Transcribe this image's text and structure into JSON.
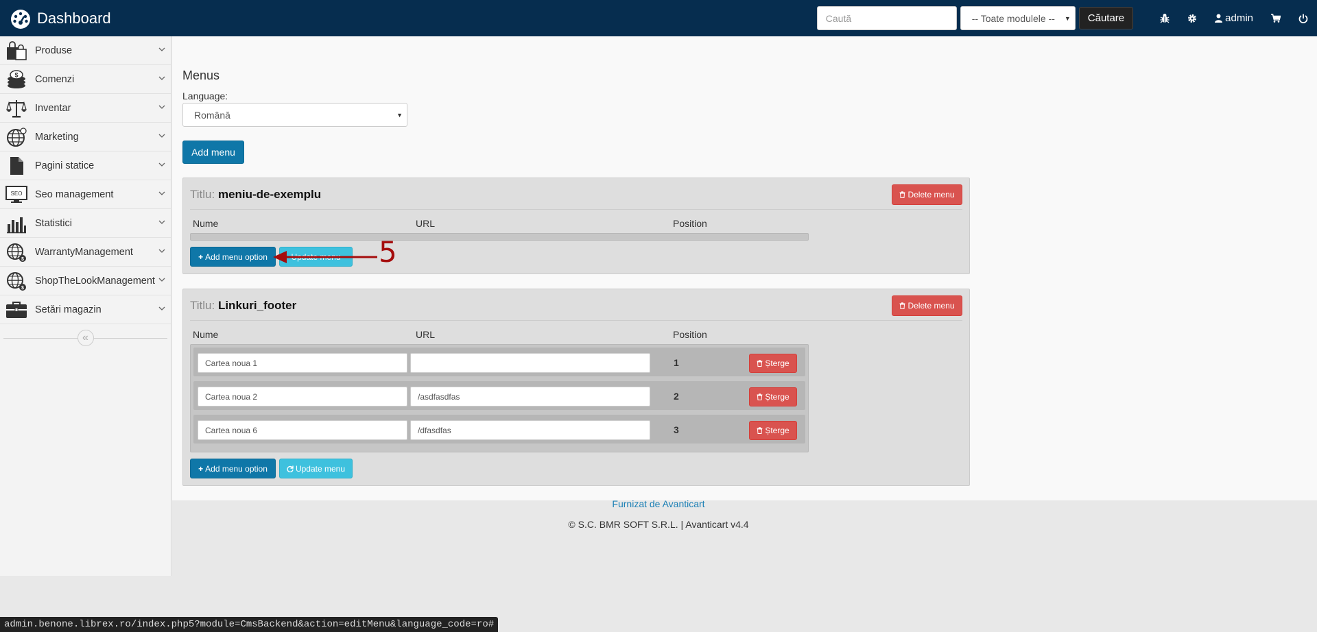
{
  "app": {
    "brand": "Dashboard"
  },
  "topbar": {
    "search_placeholder": "Caută",
    "module_select": "-- Toate modulele --",
    "search_button": "Căutare",
    "user": "admin",
    "icons": [
      "bug-icon",
      "gear-icon",
      "user-icon",
      "cart-icon",
      "power-icon"
    ]
  },
  "sidebar": {
    "items": [
      {
        "label": "Produse",
        "icon": "shopping-bags-icon"
      },
      {
        "label": "Comenzi",
        "icon": "coins-icon"
      },
      {
        "label": "Inventar",
        "icon": "scales-icon"
      },
      {
        "label": "Marketing",
        "icon": "globe-icon"
      },
      {
        "label": "Pagini statice",
        "icon": "document-icon"
      },
      {
        "label": "Seo management",
        "icon": "seo-monitor-icon"
      },
      {
        "label": "Statistici",
        "icon": "bar-chart-icon"
      },
      {
        "label": "WarrantyManagement",
        "icon": "globe-dollar-icon"
      },
      {
        "label": "ShopTheLookManagement",
        "icon": "globe-dollar-icon"
      },
      {
        "label": "Setări magazin",
        "icon": "briefcase-icon"
      }
    ],
    "collapse_symbol": "«"
  },
  "main": {
    "title": "Menus",
    "language_label": "Language:",
    "language_value": "Română",
    "add_menu": "Add menu",
    "menus": [
      {
        "title_label": "Titlu:",
        "title": "meniu-de-exemplu",
        "delete": "Delete menu",
        "columns": [
          "Nume",
          "URL",
          "Position"
        ],
        "options": [],
        "add_option": "Add menu option",
        "update": "Update menu"
      },
      {
        "title_label": "Titlu:",
        "title": "Linkuri_footer",
        "delete": "Delete menu",
        "columns": [
          "Nume",
          "URL",
          "Position"
        ],
        "options": [
          {
            "name": "Cartea noua 1",
            "url": "",
            "position": "1",
            "delete": "Șterge"
          },
          {
            "name": "Cartea noua 2",
            "url": "/asdfasdfas",
            "position": "2",
            "delete": "Șterge"
          },
          {
            "name": "Cartea noua 6",
            "url": "/dfasdfas",
            "position": "3",
            "delete": "Șterge"
          }
        ],
        "add_option": "Add menu option",
        "update": "Update menu"
      }
    ]
  },
  "footer": {
    "link": "Furnizat de Avanticart",
    "copyright": "© S.C. BMR SOFT S.R.L. | Avanticart v4.4"
  },
  "status_bar": "admin.benone.librex.ro/index.php5?module=CmsBackend&action=editMenu&language_code=ro#",
  "annotation": {
    "number": "5",
    "color": "#a50d0d"
  }
}
